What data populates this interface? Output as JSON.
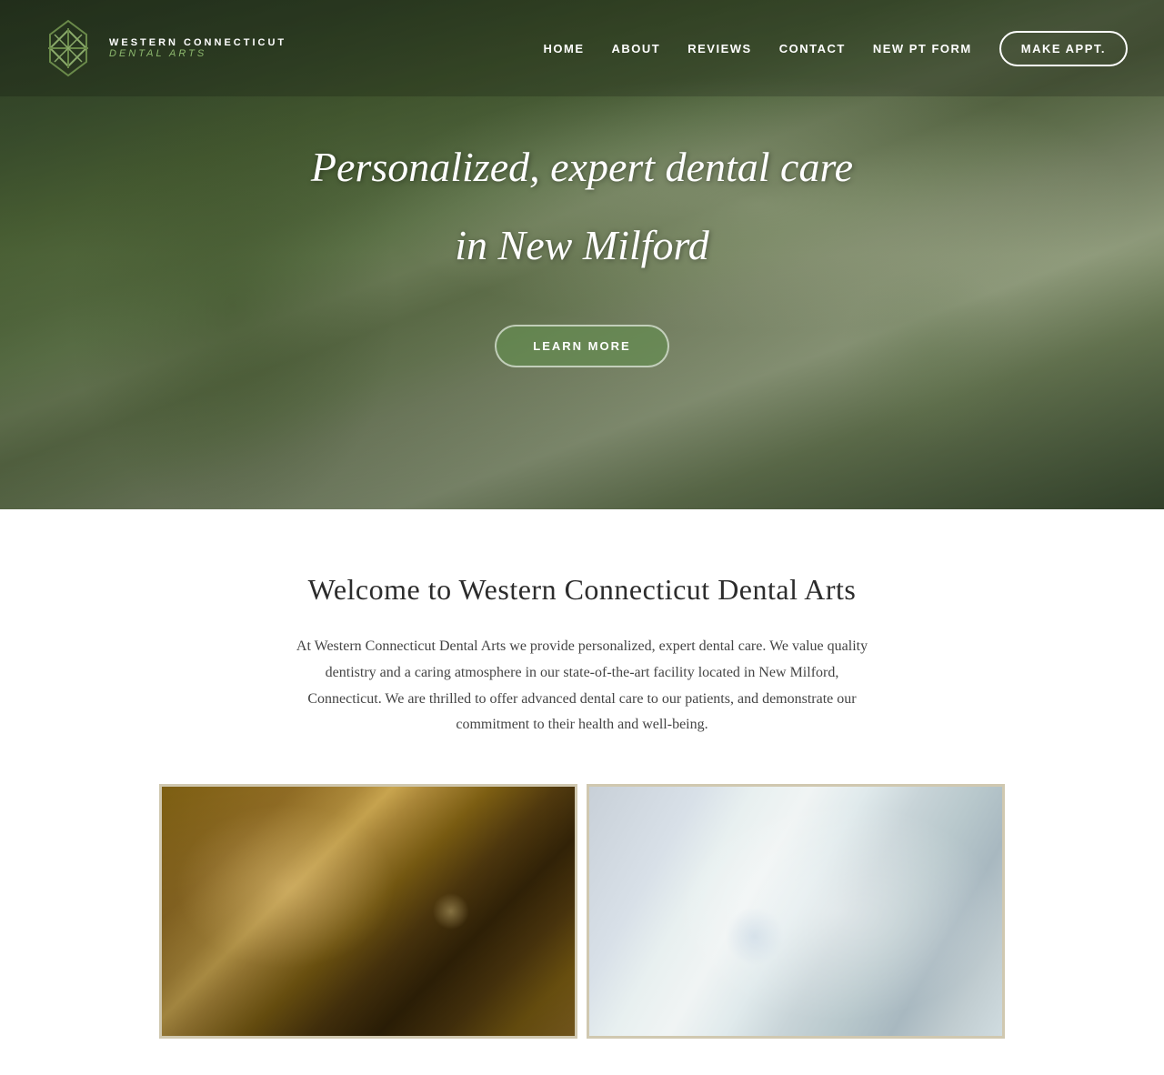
{
  "header": {
    "logo": {
      "top_text": "WESTERN CONNECTICUT",
      "bottom_text": "DENTAL ARTS"
    },
    "nav": {
      "items": [
        {
          "label": "HOME",
          "id": "home"
        },
        {
          "label": "ABOUT",
          "id": "about"
        },
        {
          "label": "REVIEWS",
          "id": "reviews"
        },
        {
          "label": "CONTACT",
          "id": "contact"
        },
        {
          "label": "NEW PT FORM",
          "id": "new-pt-form"
        }
      ],
      "cta_label": "MAKE APPT."
    }
  },
  "hero": {
    "title_line1": "Personalized, expert dental care",
    "title_line2": "in New Milford",
    "cta_label": "LEARN MORE"
  },
  "content": {
    "welcome_title": "Welcome to Western Connecticut Dental Arts",
    "welcome_text": "At Western Connecticut Dental Arts we provide personalized, expert dental care. We value quality dentistry and a caring atmosphere in our state-of-the-art facility located in New Milford, Connecticut. We are thrilled to offer advanced dental care to our patients, and demonstrate our commitment to their health and well-being."
  }
}
